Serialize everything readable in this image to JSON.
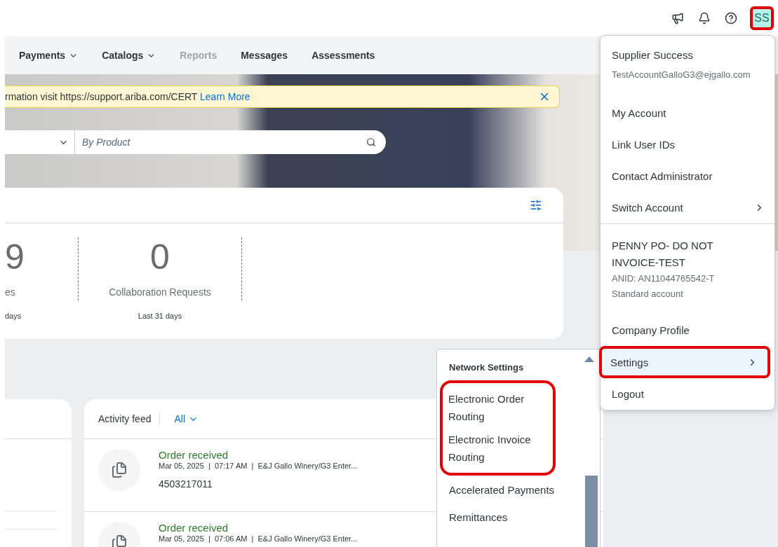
{
  "top_bar": {
    "avatar": {
      "initials": "SS",
      "highlighted": true
    }
  },
  "nav": [
    {
      "label": "Payments",
      "has_menu": true,
      "disabled": false
    },
    {
      "label": "Catalogs",
      "has_menu": true,
      "disabled": false
    },
    {
      "label": "Reports",
      "has_menu": false,
      "disabled": true
    },
    {
      "label": "Messages",
      "has_menu": false,
      "disabled": false
    },
    {
      "label": "Assessments",
      "has_menu": false,
      "disabled": false
    }
  ],
  "banner": {
    "text": "rmation visit https://support.ariba.com/CERT",
    "link": "Learn More"
  },
  "search": {
    "placeholder": "By Product"
  },
  "stats": [
    {
      "value": "9",
      "label": "es",
      "period": "days",
      "clipped": true
    },
    {
      "value": "0",
      "label": "Collaboration Requests",
      "period": "Last 31 days",
      "clipped": false
    }
  ],
  "activity": {
    "title": "Activity feed",
    "filter": "All",
    "rows": [
      {
        "title": "Order received",
        "meta": "Mar 05, 2025  |  07:17 AM  |  E&J Gallo Winery/G3 Enter...",
        "number": "4503217011"
      },
      {
        "title": "Order received",
        "meta": "Mar 05, 2025  |  07:06 AM  |  E&J Gallo Winery/G3 Enter..."
      }
    ]
  },
  "user_menu": {
    "name": "Supplier Success",
    "email": "TestAccountGalloG3@ejgallo.com",
    "items": [
      {
        "label": "My Account",
        "submenu": false
      },
      {
        "label": "Link User IDs",
        "submenu": false
      },
      {
        "label": "Contact Administrator",
        "submenu": false
      },
      {
        "label": "Switch Account",
        "submenu": true
      }
    ],
    "account": {
      "name": "PENNY PO- DO NOT INVOICE-TEST",
      "anid": "ANID: AN11044765542-T",
      "type": "Standard account"
    },
    "items2": [
      {
        "label": "Company Profile",
        "submenu": false,
        "selected": false,
        "highlighted": false
      },
      {
        "label": "Settings",
        "submenu": true,
        "selected": true,
        "highlighted": true
      },
      {
        "label": "Logout",
        "submenu": false,
        "selected": false,
        "highlighted": false
      }
    ]
  },
  "settings_menu": {
    "heading": "Network Settings",
    "highlight_group": [
      "Electronic Order Routing",
      "Electronic Invoice Routing"
    ],
    "items": [
      "Accelerated Payments",
      "Remittances"
    ]
  }
}
